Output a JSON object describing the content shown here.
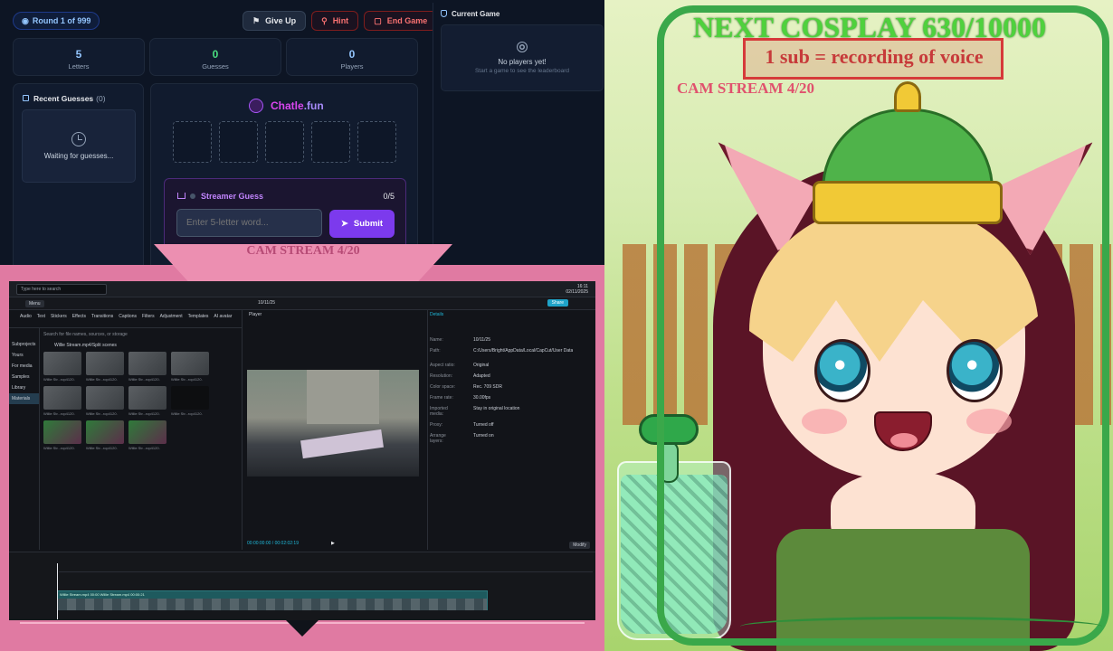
{
  "game": {
    "round_label": "Round 1 of 999",
    "buttons": {
      "give_up": "Give Up",
      "hint": "Hint",
      "end_game": "End Game"
    },
    "stats": [
      {
        "value": "5",
        "label": "Letters",
        "color": "#93c5fd"
      },
      {
        "value": "0",
        "label": "Guesses",
        "color": "#4ade80"
      },
      {
        "value": "0",
        "label": "Players",
        "color": "#93c5fd"
      }
    ],
    "recent": {
      "title": "Recent Guesses",
      "count": "(0)",
      "empty_text": "Waiting for guesses..."
    },
    "brand": {
      "part1": "Chatle",
      "part2": ".fun"
    },
    "streamer": {
      "title": "Streamer Guess",
      "count": "0/5",
      "placeholder": "Enter 5-letter word...",
      "submit_label": "Submit"
    },
    "current_game": {
      "title": "Current Game",
      "empty_title": "No players yet!",
      "empty_sub": "Start a game to see the leaderboard"
    }
  },
  "overlay": {
    "cam_stream_label": "CAM STREAM 4/20",
    "next_cosplay": "NEXT COSPLAY 630/10000",
    "sub_line": "1 sub = recording of voice",
    "cam_stream_label_2": "CAM STREAM 4/20"
  },
  "editor": {
    "search_placeholder": "Type here to search",
    "clock_time": "16:11",
    "clock_date": "02/11/2025",
    "menu_label": "Menu",
    "project_title": "10/11/25",
    "share_label": "Share",
    "tools": [
      "Audio",
      "Text",
      "Stickers",
      "Effects",
      "Transitions",
      "Captions",
      "Filters",
      "Adjustment",
      "Templates",
      "AI avatar"
    ],
    "sidebar": [
      "Subprojects",
      "Yours",
      "For media",
      "Samples",
      "Library",
      "Materials"
    ],
    "media_search": "Search for file names, sources, or storage",
    "folder_path": "Willie Stream.mp4/Split scenes",
    "thumbs": [
      {
        "cap": "Willie Str...rop4120.",
        "style": "plain"
      },
      {
        "cap": "Willie Str...rop4120.",
        "style": "plain"
      },
      {
        "cap": "Willie Str...rop4120.",
        "style": "plain"
      },
      {
        "cap": "Willie Str...rop4120.",
        "style": "plain"
      },
      {
        "cap": "Willie Str...rop4120.",
        "style": "plain"
      },
      {
        "cap": "Willie Str...rop4120.",
        "style": "plain"
      },
      {
        "cap": "Willie Str...rop4120.",
        "style": "plain"
      },
      {
        "cap": "Willie Str...rop4120.",
        "style": "dark"
      },
      {
        "cap": "Willie Str...rop4120.",
        "style": "green"
      },
      {
        "cap": "Willie Str...rop4120.",
        "style": "green"
      },
      {
        "cap": "Willie Str...rop4120.",
        "style": "green"
      }
    ],
    "player_label": "Player",
    "timecode": "00:00:00:00 / 00:02:02:19",
    "details_label": "Details",
    "details": [
      {
        "k": "Name:",
        "v": "10/11/25"
      },
      {
        "k": "Path:",
        "v": "C:/Users/Bright/AppData/Local/CapCut/User Data/Projects/"
      },
      {
        "k": "Aspect ratio:",
        "v": "Original"
      },
      {
        "k": "Resolution:",
        "v": "Adapted"
      },
      {
        "k": "Color space:",
        "v": "Rec. 709 SDR"
      },
      {
        "k": "Frame rate:",
        "v": "30.00fps"
      },
      {
        "k": "Imported media:",
        "v": "Stay in original location"
      },
      {
        "k": "Proxy:",
        "v": "Turned off"
      },
      {
        "k": "Arrange layers:",
        "v": "Turned on"
      }
    ],
    "modify_label": "Modify",
    "track_caption": "Willie Stream.mp4  00:00  Willie Stream.mp4  00:00:21"
  },
  "colors": {
    "game_bg": "#0d1524",
    "accent_purple": "#7c3aed",
    "frame_pink": "#e07aa2",
    "cam_green": "#3aa84a"
  }
}
